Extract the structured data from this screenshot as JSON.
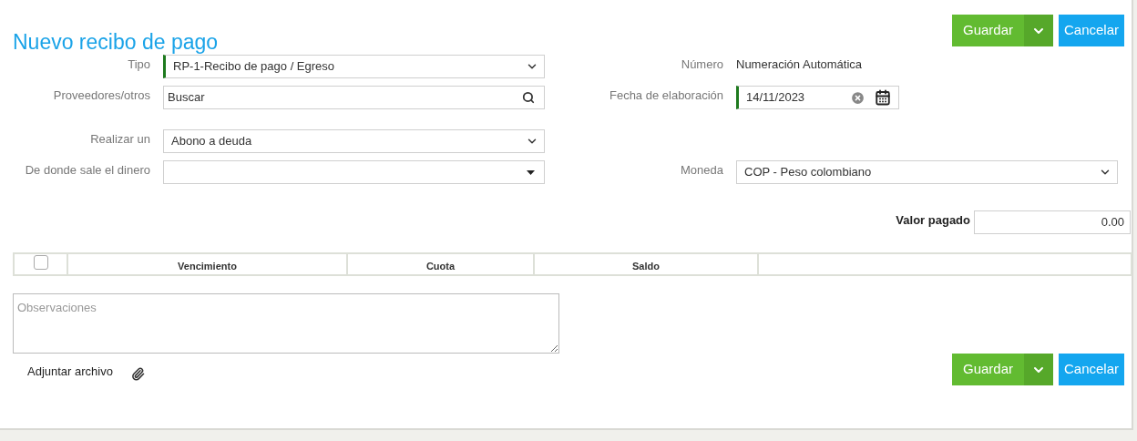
{
  "title": "Nuevo recibo de pago",
  "top_actions": {
    "save": "Guardar",
    "cancel": "Cancelar"
  },
  "rows": [
    {
      "left": {
        "label": "Tipo",
        "kind": "select",
        "value": "RP-1-Recibo de pago / Egreso",
        "required": true
      },
      "right": {
        "label": "Número",
        "kind": "text",
        "value": "Numeración Automática"
      }
    },
    {
      "left": {
        "label": "Proveedores/otros",
        "kind": "search",
        "placeholder": "Buscar",
        "required": false
      },
      "right": {
        "label": "Fecha de elaboración",
        "kind": "date",
        "value": "14/11/2023",
        "required": true
      }
    },
    {
      "left": {
        "label": "Realizar un",
        "kind": "select",
        "value": "Abono a deuda",
        "required": false
      }
    },
    {
      "left": {
        "label": "De donde sale el dinero",
        "kind": "dropdown",
        "required": false
      },
      "right": {
        "label": "Moneda",
        "kind": "select",
        "value": "COP - Peso colombiano",
        "required": false
      }
    }
  ],
  "amount": {
    "label": "Valor pagado",
    "value": "0.00"
  },
  "table": {
    "select_all_checked": false,
    "columns": [
      "Vencimiento",
      "Cuota",
      "Saldo"
    ]
  },
  "notes": {
    "placeholder": "Observaciones"
  },
  "attach": {
    "label": "Adjuntar archivo"
  },
  "bottom_actions": {
    "save": "Guardar",
    "cancel": "Cancelar"
  }
}
